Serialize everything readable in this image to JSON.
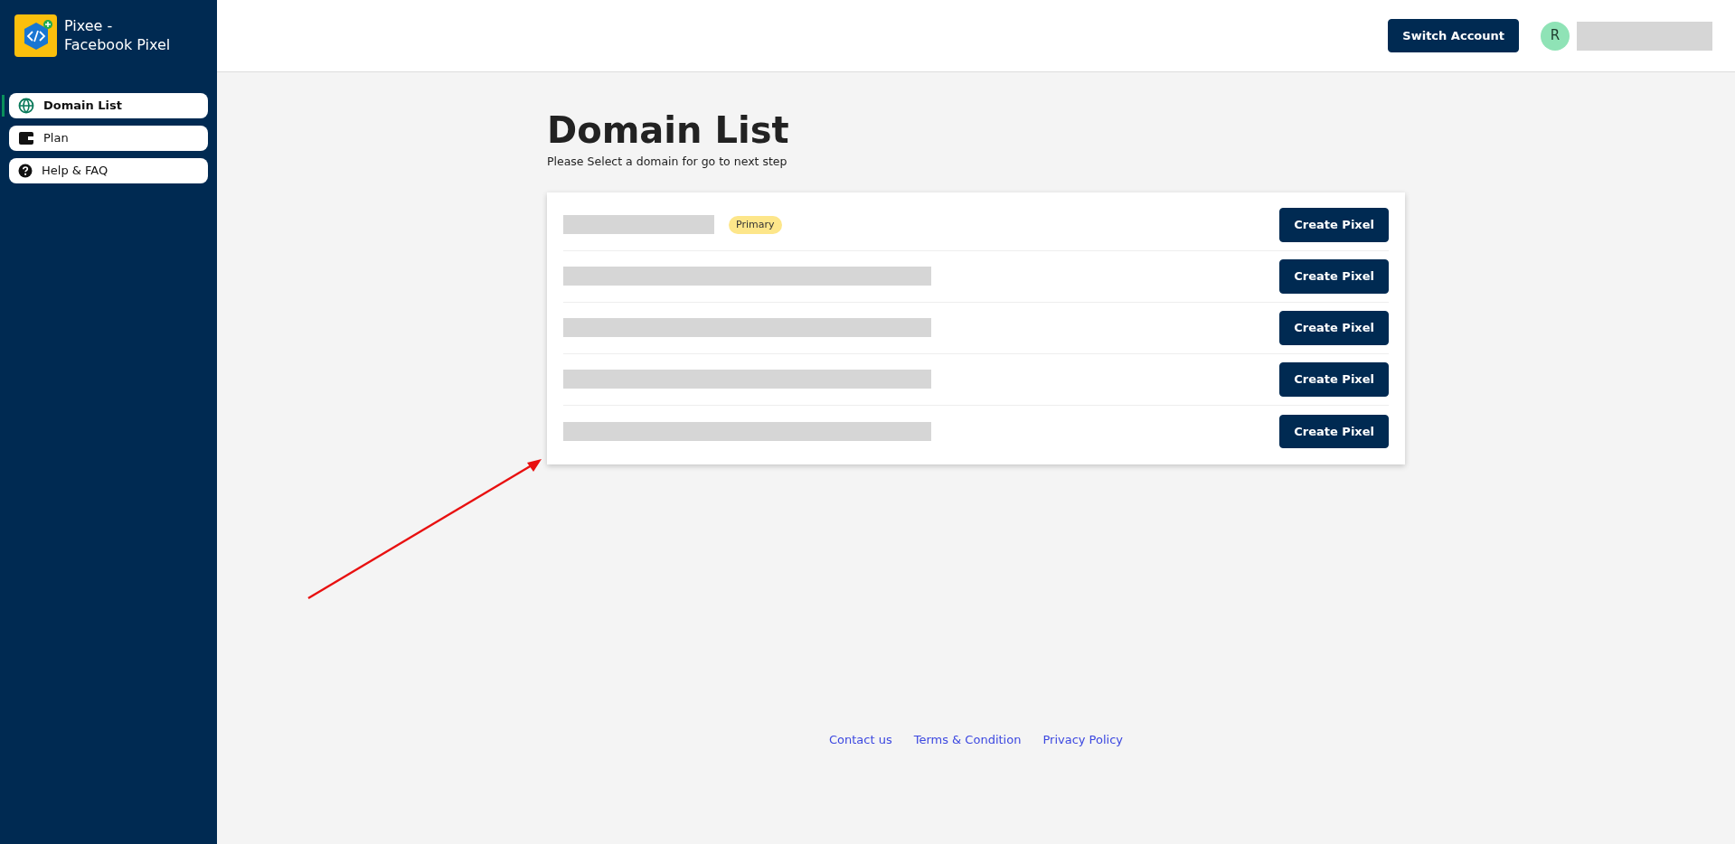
{
  "app": {
    "name_line1": "Pixee -",
    "name_line2": "Facebook Pixel"
  },
  "sidebar": {
    "items": [
      {
        "label": "Domain List",
        "selected": true
      },
      {
        "label": "Plan",
        "selected": false
      },
      {
        "label": "Help & FAQ",
        "selected": false
      }
    ]
  },
  "header": {
    "switch_button": "Switch Account",
    "avatar_initial": "R"
  },
  "page": {
    "title": "Domain List",
    "subtitle": "Please Select a domain for go to next step"
  },
  "domains": [
    {
      "badge": "Primary",
      "button": "Create Pixel"
    },
    {
      "button": "Create Pixel"
    },
    {
      "button": "Create Pixel"
    },
    {
      "button": "Create Pixel"
    },
    {
      "button": "Create Pixel"
    }
  ],
  "footer": {
    "links": [
      "Contact us",
      "Terms & Condition",
      "Privacy Policy"
    ]
  }
}
